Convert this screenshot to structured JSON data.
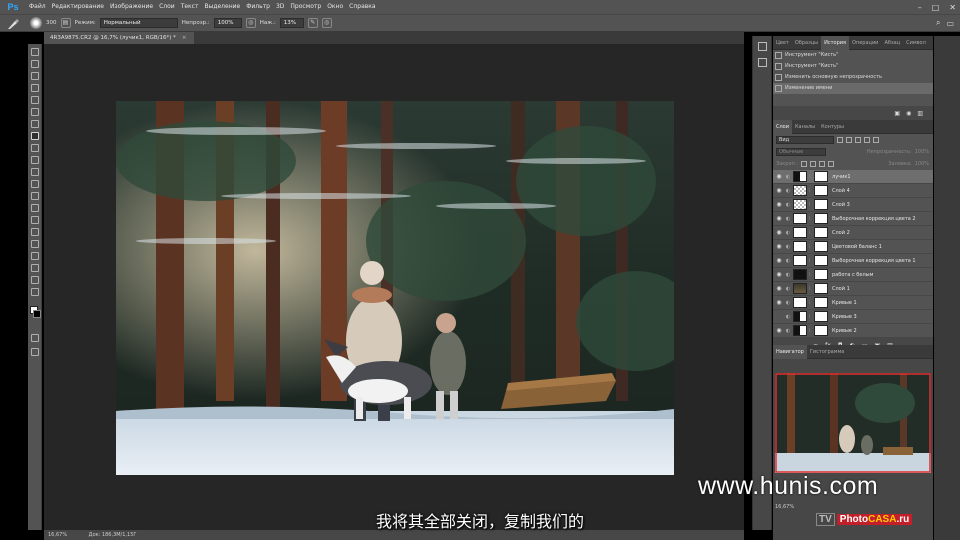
{
  "app": {
    "logo": "Ps"
  },
  "menu": [
    "Файл",
    "Редактирование",
    "Изображение",
    "Слои",
    "Текст",
    "Выделение",
    "Фильтр",
    "3D",
    "Просмотр",
    "Окно",
    "Справка"
  ],
  "window_controls": [
    "–",
    "□",
    "✕"
  ],
  "options": {
    "brush_size": "300",
    "mode_label": "Режим:",
    "mode_value": "Нормальный",
    "opacity_label": "Непрозр.:",
    "opacity_value": "100%",
    "pressure_label": "Наж.:",
    "pressure_value": "13%"
  },
  "doc_tab": {
    "title": "4R3A9875.CR2 @ 16,7% (лучик1, RGB/16*) *",
    "close": "×"
  },
  "status": {
    "zoom": "16,67%",
    "doc": "Док: 186,3M/1,15Г"
  },
  "history": {
    "tabs": [
      "Цвет",
      "Образцы",
      "История",
      "Операции",
      "Абзац",
      "Символ"
    ],
    "active_tab": 2,
    "items": [
      "Инструмент \"Кисть\"",
      "Инструмент \"Кисть\"",
      "Изменить основную непрозрачность",
      "Изменение имени"
    ],
    "selected_index": 3
  },
  "layers": {
    "tabs": [
      "Слои",
      "Каналы",
      "Контуры"
    ],
    "active_tab": 0,
    "filter_label": "Вид",
    "blend_label": "Обычные",
    "opacity_label": "Непрозрачность:",
    "opacity_value": "100%",
    "lock_label": "Закреп.:",
    "fill_label": "Заливка:",
    "fill_value": "100%",
    "items": [
      {
        "name": "лучик1",
        "thumb": "mask",
        "visible": true,
        "selected": true
      },
      {
        "name": "Слой 4",
        "thumb": "checker",
        "visible": true,
        "selected": false
      },
      {
        "name": "Слой 3",
        "thumb": "checker",
        "visible": true,
        "selected": false
      },
      {
        "name": "Выборочная коррекция цвета 2",
        "thumb": "white",
        "visible": true,
        "selected": false
      },
      {
        "name": "Слой 2",
        "thumb": "white",
        "visible": true,
        "selected": false
      },
      {
        "name": "Цветовой баланс 1",
        "thumb": "white",
        "visible": true,
        "selected": false
      },
      {
        "name": "Выборочная коррекция цвета 1",
        "thumb": "white",
        "visible": true,
        "selected": false
      },
      {
        "name": "работа с белым",
        "thumb": "black",
        "visible": true,
        "selected": false
      },
      {
        "name": "Слой 1",
        "thumb": "photo",
        "visible": true,
        "selected": false
      },
      {
        "name": "Кривые 1",
        "thumb": "white",
        "visible": true,
        "selected": false
      },
      {
        "name": "Кривые 3",
        "thumb": "mask",
        "visible": false,
        "selected": false
      },
      {
        "name": "Кривые 2",
        "thumb": "mask",
        "visible": true,
        "selected": false
      }
    ]
  },
  "navigator": {
    "tabs": [
      "Навигатор",
      "Гистограмма"
    ],
    "active_tab": 0,
    "zoom": "16,67%"
  },
  "overlay": {
    "watermark": "www.hunis.com",
    "logo_tv": "TV",
    "logo_photo": "Photo",
    "logo_casa": "CASA",
    "logo_ru": ".ru",
    "subtitle": "我将其全部关闭，复制我们的"
  },
  "colors": {
    "ui_dark": "#535353",
    "canvas_bg": "#262626",
    "ps_blue": "#31a8ff"
  }
}
